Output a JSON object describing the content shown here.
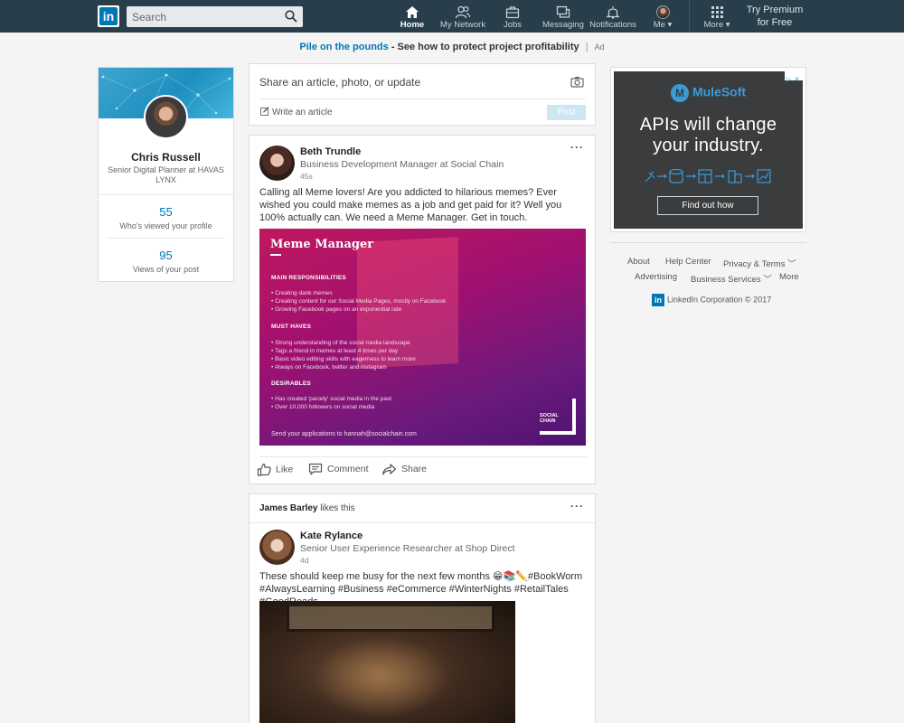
{
  "nav": {
    "logo": "in",
    "search_placeholder": "Search",
    "items": [
      {
        "label": "Home",
        "icon": "home-icon",
        "active": true
      },
      {
        "label": "My Network",
        "icon": "network-icon"
      },
      {
        "label": "Jobs",
        "icon": "briefcase-icon"
      },
      {
        "label": "Messaging",
        "icon": "messaging-icon"
      },
      {
        "label": "Notifications",
        "icon": "bell-icon"
      },
      {
        "label": "Me ▾",
        "icon": "avatar"
      },
      {
        "label": "More ▾",
        "icon": "grid-icon"
      }
    ],
    "premium": {
      "line1": "Try Premium",
      "line2": "for Free"
    }
  },
  "adline": {
    "highlight": "Pile on the pounds",
    "text": " - See how to protect project profitability",
    "separator": "|",
    "ad": "Ad"
  },
  "profile": {
    "name": "Chris Russell",
    "title": "Senior Digital Planner at HAVAS LYNX",
    "stats": [
      {
        "value": "55",
        "label": "Who's viewed your profile"
      },
      {
        "value": "95",
        "label": "Views of your post"
      }
    ]
  },
  "share": {
    "placeholder": "Share an article, photo, or update",
    "write_article": "Write an article",
    "post_button": "Post"
  },
  "posts": [
    {
      "author": "Beth Trundle",
      "headline": "Business Development Manager at Social Chain",
      "time": "45s",
      "text": "Calling all Meme lovers! Are you addicted to hilarious memes? Ever wished you could make memes as a job and get paid for it? Well you 100% actually can. We need a Meme Manager. Get in touch.",
      "image": {
        "title": "Meme Manager",
        "sections": [
          {
            "heading": "MAIN RESPONSIBILITIES",
            "items": [
              "• Creating dank memes",
              "• Creating content for our Social Media Pages, mostly on Facebook",
              "• Growing Facebook pages on an exponential rate"
            ]
          },
          {
            "heading": "MUST HAVES",
            "items": [
              "• Strong understanding of the social media landscape",
              "• Tags a friend in memes at least 4 times per day",
              "• Basic video editing skills with eagerness to learn more",
              "• Always on Facebook, twitter and instagram"
            ]
          },
          {
            "heading": "DESIRABLES",
            "items": [
              "• Has created 'parody' social media in the past",
              "• Over 10,000 followers on social media"
            ]
          }
        ],
        "footer": "Send your applications to hannah@socialchain.com",
        "brand_line1": "SOCIAL",
        "brand_line2": "CHAIN"
      },
      "actions": [
        "Like",
        "Comment",
        "Share"
      ]
    },
    {
      "liker": "James Barley",
      "likes_suffix": " likes this",
      "author": "Kate Rylance",
      "headline": "Senior User Experience Researcher at Shop Direct",
      "time": "4d",
      "text": "These should keep me busy for the next few months 😁📚✏️#BookWorm #AlwaysLearning #Business #eCommerce #WinterNights #RetailTales #GoodReads"
    }
  ],
  "ad": {
    "brand": "MuleSoft",
    "headline_line1": "APIs will change",
    "headline_line2": "your industry.",
    "button": "Find out how",
    "tag1": "▷",
    "tag2": "✕"
  },
  "footer": {
    "links": [
      "About",
      "Help Center",
      "Privacy & Terms ﹀",
      "Advertising",
      "Business Services ﹀",
      "More"
    ],
    "corp": "LinkedIn Corporation © 2017",
    "corp_logo": "in"
  },
  "colors": {
    "nav_bg": "#283e4a",
    "brand": "#0077b5",
    "page_bg": "#f4f4f4"
  }
}
